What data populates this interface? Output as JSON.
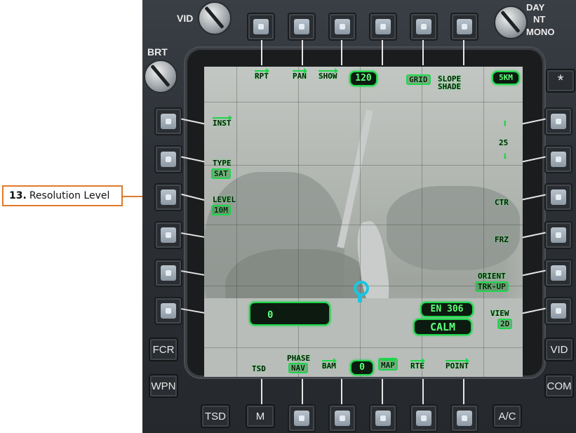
{
  "callout": {
    "number": "13.",
    "text": "Resolution Level"
  },
  "knobs": {
    "vid": "VID",
    "brt": "BRT",
    "day": "DAY",
    "nt": "NT",
    "mono": "MONO"
  },
  "bezel_buttons": {
    "fcr": "FCR",
    "wpn": "WPN",
    "vid": "VID",
    "com": "COM",
    "tsd": "TSD",
    "m": "M",
    "ac": "A/C",
    "star": "*"
  },
  "map": {
    "top": {
      "rpt": "RPT",
      "pan": "PAN",
      "show": "SHOW",
      "show_value": "120",
      "grid": "GRID",
      "slope1": "SLOPE",
      "slope2": "SHADE",
      "scale": "5KM"
    },
    "left": {
      "inst": "INST",
      "type_label": "TYPE",
      "type_value": "SAT",
      "level_label": "LEVEL",
      "level_value": "10M"
    },
    "right": {
      "up_arrow": "⬆",
      "zoom_value": "25",
      "down_arrow": "⬇",
      "ctr": "CTR",
      "frz": "FRZ",
      "orient_label": "ORIENT",
      "orient_value": "TRK-UP",
      "view_label": "VIEW",
      "view_value": "2D"
    },
    "bottom": {
      "tsd": "TSD",
      "phase_label": "PHASE",
      "phase_value": "NAV",
      "bam": "BAM",
      "bam_value": "0",
      "map": "MAP",
      "rte": "RTE",
      "point": "POINT"
    },
    "readout_left": "0",
    "wind_heading": "EN 306",
    "wind_state": "CALM"
  }
}
